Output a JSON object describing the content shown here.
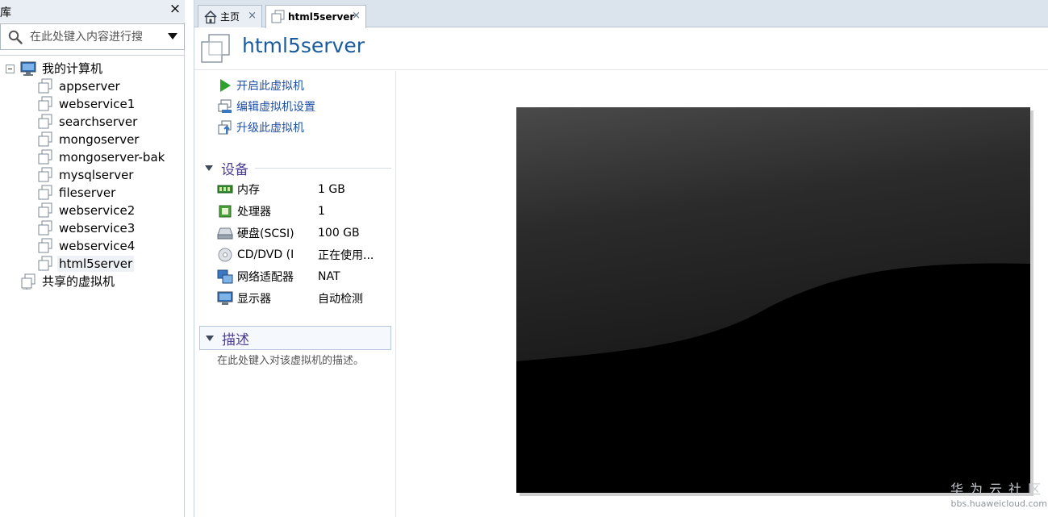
{
  "library": {
    "title": "库",
    "close_glyph": "×",
    "search_placeholder": "在此处键入内容进行搜",
    "tree": {
      "root": {
        "label": "我的计算机",
        "icon": "computer-icon"
      },
      "vms": [
        {
          "label": "appserver",
          "icon": "vm-icon"
        },
        {
          "label": "webservice1",
          "icon": "vm-icon"
        },
        {
          "label": "searchserver",
          "icon": "vm-icon"
        },
        {
          "label": "mongoserver",
          "icon": "vm-icon"
        },
        {
          "label": "mongoserver-bak",
          "icon": "vm-icon"
        },
        {
          "label": "mysqlserver",
          "icon": "vm-icon"
        },
        {
          "label": "fileserver",
          "icon": "vm-icon"
        },
        {
          "label": "webservice2",
          "icon": "vm-icon"
        },
        {
          "label": "webservice3",
          "icon": "vm-icon"
        },
        {
          "label": "webservice4",
          "icon": "vm-icon"
        },
        {
          "label": "html5server",
          "icon": "vm-icon",
          "selected": true
        }
      ],
      "shared": {
        "label": "共享的虚拟机",
        "icon": "shared-vm-icon"
      }
    }
  },
  "tabs": [
    {
      "label": "主页",
      "icon": "home-icon",
      "close": "×"
    },
    {
      "label": "html5server",
      "icon": "vm-icon",
      "close": "×",
      "active": true
    }
  ],
  "vm": {
    "title": "html5server",
    "actions": [
      {
        "label": "开启此虚拟机",
        "icon": "play-icon"
      },
      {
        "label": "编辑虚拟机设置",
        "icon": "edit-settings-icon"
      },
      {
        "label": "升级此虚拟机",
        "icon": "upgrade-icon"
      }
    ],
    "devices_heading": "设备",
    "devices": [
      {
        "name": "内存",
        "value": "1 GB",
        "icon": "memory-icon"
      },
      {
        "name": "处理器",
        "value": "1",
        "icon": "processor-icon"
      },
      {
        "name": "硬盘(SCSI)",
        "value": "100 GB",
        "icon": "hard-disk-icon"
      },
      {
        "name": "CD/DVD (I",
        "value": "正在使用...",
        "icon": "cd-dvd-icon"
      },
      {
        "name": "网络适配器",
        "value": "NAT",
        "icon": "network-adapter-icon"
      },
      {
        "name": "显示器",
        "value": "自动检测",
        "icon": "display-icon"
      }
    ],
    "description_heading": "描述",
    "description_placeholder": "在此处键入对该虚拟机的描述。"
  },
  "watermark": {
    "brand": "华为云社区",
    "url": "bbs.huaweicloud.com"
  },
  "colors": {
    "title_blue": "#1b5c9e",
    "link_blue": "#1d4fa8",
    "section_purple": "#4b3d8f",
    "play_green": "#2fa12f"
  }
}
